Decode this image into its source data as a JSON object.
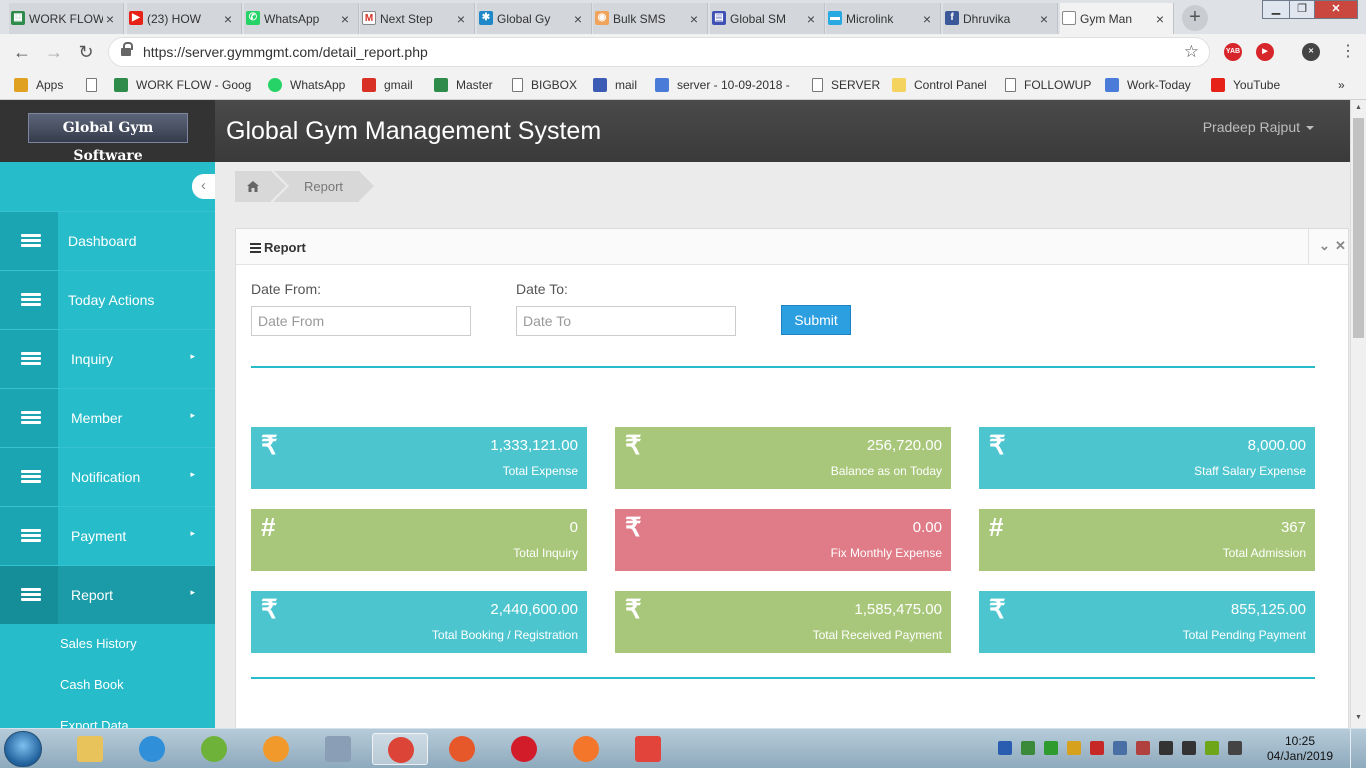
{
  "browser": {
    "tabs": [
      {
        "title": "WORK FLOW",
        "fav_color": "#2e8b4a",
        "fav_glyph": "▦"
      },
      {
        "title": "(23) HOW",
        "fav_color": "#e62117",
        "fav_glyph": "▶"
      },
      {
        "title": "WhatsApp",
        "fav_color": "#25d366",
        "fav_glyph": "✆"
      },
      {
        "title": "Next Step",
        "fav_color": "#ffffff",
        "fav_glyph": "M"
      },
      {
        "title": "Global Gy",
        "fav_color": "#1e88c8",
        "fav_glyph": "✱"
      },
      {
        "title": "Bulk SMS",
        "fav_color": "#f0a35a",
        "fav_glyph": "◉"
      },
      {
        "title": "Global SM",
        "fav_color": "#3f51b5",
        "fav_glyph": "▤"
      },
      {
        "title": "Microlink",
        "fav_color": "#29a9e1",
        "fav_glyph": "▬"
      },
      {
        "title": "Dhruvika",
        "fav_color": "#3b5998",
        "fav_glyph": "f"
      },
      {
        "title": "Gym Man",
        "fav_color": "#ffffff",
        "fav_glyph": ""
      }
    ],
    "new_tab_symbol": "+",
    "url": "https://server.gymmgmt.com/detail_report.php",
    "extensions": [
      {
        "label": "YAB",
        "color": "#d7262b"
      },
      {
        "label": "▶",
        "color": "#d7262b"
      },
      {
        "label": "✕",
        "color": "#444444"
      }
    ],
    "bookmarks": [
      {
        "label": "Apps",
        "icon": "apps-grid-icon"
      },
      {
        "label": "",
        "icon": "page-icon"
      },
      {
        "label": "WORK FLOW - Goog",
        "icon": "sheets-icon"
      },
      {
        "label": "WhatsApp",
        "icon": "whatsapp-icon"
      },
      {
        "label": "gmail",
        "icon": "gmail-icon"
      },
      {
        "label": "Master",
        "icon": "sheets-icon"
      },
      {
        "label": "BIGBOX",
        "icon": "page-icon"
      },
      {
        "label": "mail",
        "icon": "mail-icon"
      },
      {
        "label": "server - 10-09-2018 -",
        "icon": "docs-icon"
      },
      {
        "label": "SERVER",
        "icon": "page-icon"
      },
      {
        "label": "Control Panel",
        "icon": "folder-icon"
      },
      {
        "label": "FOLLOWUP",
        "icon": "page-icon"
      },
      {
        "label": "Work-Today",
        "icon": "docs-icon"
      },
      {
        "label": "YouTube",
        "icon": "youtube-icon"
      }
    ],
    "more_bookmarks": "»"
  },
  "app": {
    "logo_text": "Global Gym Software",
    "title": "Global Gym Management System",
    "user_name": "Pradeep Rajput"
  },
  "sidebar": {
    "items": [
      {
        "label": "Dashboard",
        "has_arrow": false
      },
      {
        "label": "Today Actions",
        "has_arrow": false
      },
      {
        "label": "Inquiry",
        "has_arrow": true
      },
      {
        "label": "Member",
        "has_arrow": true
      },
      {
        "label": "Notification",
        "has_arrow": true
      },
      {
        "label": "Payment",
        "has_arrow": true
      },
      {
        "label": "Report",
        "has_arrow": true,
        "active": true
      }
    ],
    "sub_items": [
      "Sales History",
      "Cash Book",
      "Export Data"
    ]
  },
  "breadcrumb": {
    "home_icon": "home-icon",
    "current": "Report"
  },
  "report": {
    "panel_title": "Report",
    "date_from_label": "Date From:",
    "date_from_placeholder": "Date From",
    "date_to_label": "Date To:",
    "date_to_placeholder": "Date To",
    "submit_label": "Submit",
    "stats": [
      {
        "symbol": "₹",
        "value": "1,333,121.00",
        "caption": "Total Expense",
        "color": "teal"
      },
      {
        "symbol": "₹",
        "value": "256,720.00",
        "caption": "Balance as on Today",
        "color": "green"
      },
      {
        "symbol": "₹",
        "value": "8,000.00",
        "caption": "Staff Salary Expense",
        "color": "teal"
      },
      {
        "symbol": "#",
        "value": "0",
        "caption": "Total Inquiry",
        "color": "green"
      },
      {
        "symbol": "₹",
        "value": "0.00",
        "caption": "Fix Monthly Expense",
        "color": "red"
      },
      {
        "symbol": "#",
        "value": "367",
        "caption": "Total Admission",
        "color": "green"
      },
      {
        "symbol": "₹",
        "value": "2,440,600.00",
        "caption": "Total Booking / Registration",
        "color": "teal"
      },
      {
        "symbol": "₹",
        "value": "1,585,475.00",
        "caption": "Total Received Payment",
        "color": "green"
      },
      {
        "symbol": "₹",
        "value": "855,125.00",
        "caption": "Total Pending Payment",
        "color": "teal"
      }
    ]
  },
  "taskbar": {
    "apps": [
      {
        "name": "file-explorer-icon",
        "color": "#e8c25a"
      },
      {
        "name": "internet-explorer-icon",
        "color": "#2f8fd8"
      },
      {
        "name": "app-green-icon",
        "color": "#6fb23a"
      },
      {
        "name": "media-player-icon",
        "color": "#f19a2b"
      },
      {
        "name": "paint-icon",
        "color": "#8a9fb5"
      },
      {
        "name": "chrome-icon",
        "color": "#db4437",
        "active": true
      },
      {
        "name": "firefox-dev-icon",
        "color": "#e6572a"
      },
      {
        "name": "opera-icon",
        "color": "#d31c2a"
      },
      {
        "name": "firefox-icon",
        "color": "#f4762a"
      },
      {
        "name": "anydesk-icon",
        "color": "#e2433b"
      }
    ],
    "time": "10:25",
    "date": "04/Jan/2019"
  }
}
